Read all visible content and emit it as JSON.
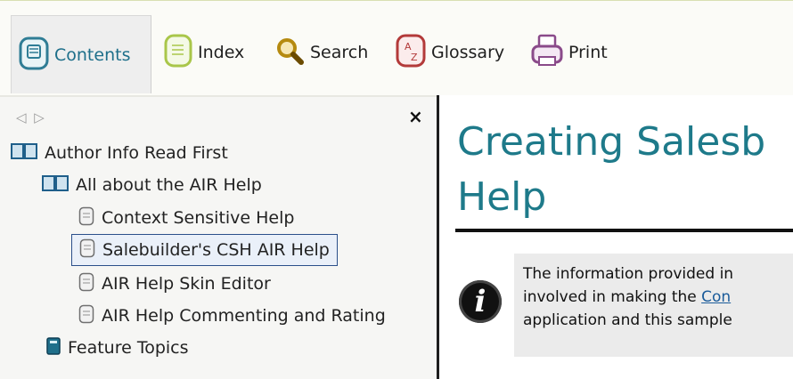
{
  "toolbar": {
    "items": [
      {
        "label": "Contents",
        "icon": "contents-book-icon"
      },
      {
        "label": "Index",
        "icon": "index-page-icon"
      },
      {
        "label": "Search",
        "icon": "magnifier-icon"
      },
      {
        "label": "Glossary",
        "icon": "a-z-glossary-icon"
      },
      {
        "label": "Print",
        "icon": "printer-icon"
      }
    ],
    "active": "Contents",
    "accent": "#1e6f8a"
  },
  "toc": {
    "nav_arrows": "◁ ▷",
    "close": "×",
    "items": [
      {
        "label": "Author Info Read First",
        "icon": "open-book-icon",
        "level": 0
      },
      {
        "label": "All about the AIR Help",
        "icon": "open-book-icon",
        "level": 1
      },
      {
        "label": "Context Sensitive Help",
        "icon": "page-icon",
        "level": 2
      },
      {
        "label": "Salebuilder's CSH AIR Help",
        "icon": "page-icon",
        "level": 2,
        "selected": true
      },
      {
        "label": "AIR Help Skin Editor",
        "icon": "page-icon",
        "level": 2
      },
      {
        "label": "AIR Help Commenting and Rating",
        "icon": "page-icon",
        "level": 2
      },
      {
        "label": "Feature Topics",
        "icon": "closed-book-icon",
        "level": 1
      }
    ]
  },
  "content": {
    "heading_line1": "Creating Salesb",
    "heading_line2": "Help",
    "note": {
      "icon": "info-icon",
      "line1": "The information provided in",
      "line2_before": "involved in making the ",
      "line2_link": "Con",
      "line3": "application and this sample"
    },
    "heading_color": "#1e7a8a"
  }
}
